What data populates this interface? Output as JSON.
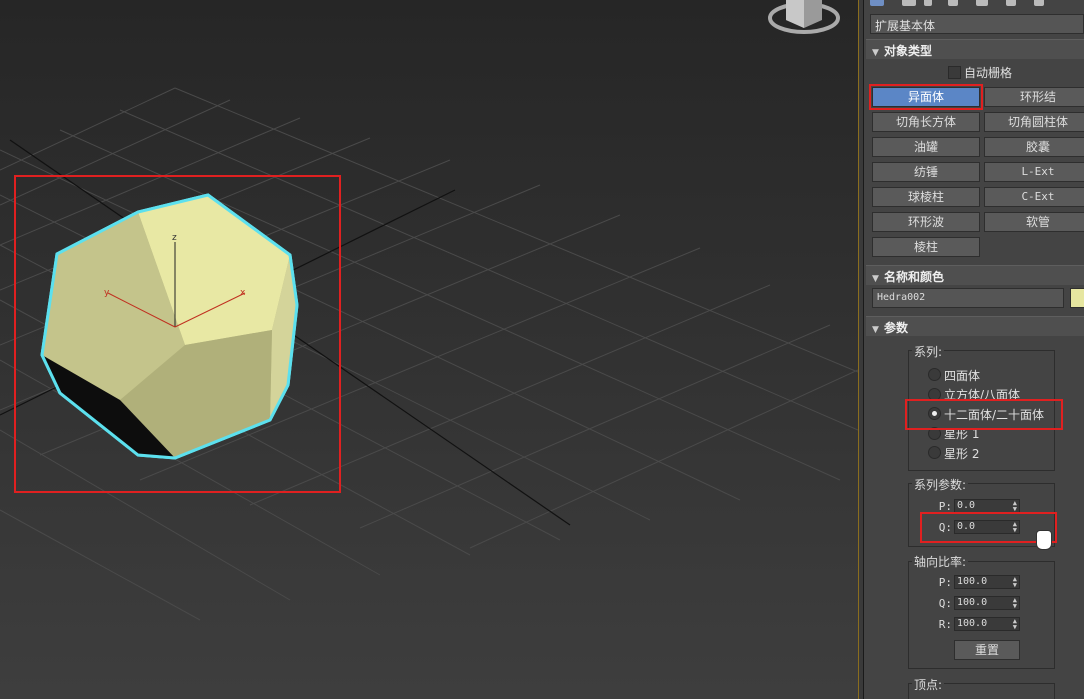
{
  "viewport": {
    "axes": {
      "x": "x",
      "y": "y",
      "z": "z"
    },
    "object_color": "#e6e6a0",
    "selection_color": "#5ce0ee"
  },
  "panel": {
    "dropdown_value": "扩展基本体",
    "object_type": {
      "title": "对象类型",
      "autogrid_label": "自动栅格",
      "buttons": [
        "异面体",
        "环形结",
        "切角长方体",
        "切角圆柱体",
        "油罐",
        "胶囊",
        "纺锤",
        "L-Ext",
        "球棱柱",
        "C-Ext",
        "环形波",
        "软管",
        "棱柱"
      ],
      "selected": "异面体"
    },
    "name_color": {
      "title": "名称和颜色",
      "name_value": "Hedra002",
      "swatch_color": "#e6e6a0"
    },
    "params": {
      "title": "参数",
      "family_title": "系列:",
      "family_options": [
        "四面体",
        "立方体/八面体",
        "十二面体/二十面体",
        "星形 1",
        "星形 2"
      ],
      "family_selected": "十二面体/二十面体",
      "family_params_title": "系列参数:",
      "family_p_label": "P:",
      "family_p_value": "0.0",
      "family_q_label": "Q:",
      "family_q_value": "0.0",
      "axis_title": "轴向比率:",
      "axis_p_label": "P:",
      "axis_p_value": "100.0",
      "axis_q_label": "Q:",
      "axis_q_value": "100.0",
      "axis_r_label": "R:",
      "axis_r_value": "100.0",
      "reset_label": "重置",
      "vertex_title": "顶点:"
    }
  }
}
